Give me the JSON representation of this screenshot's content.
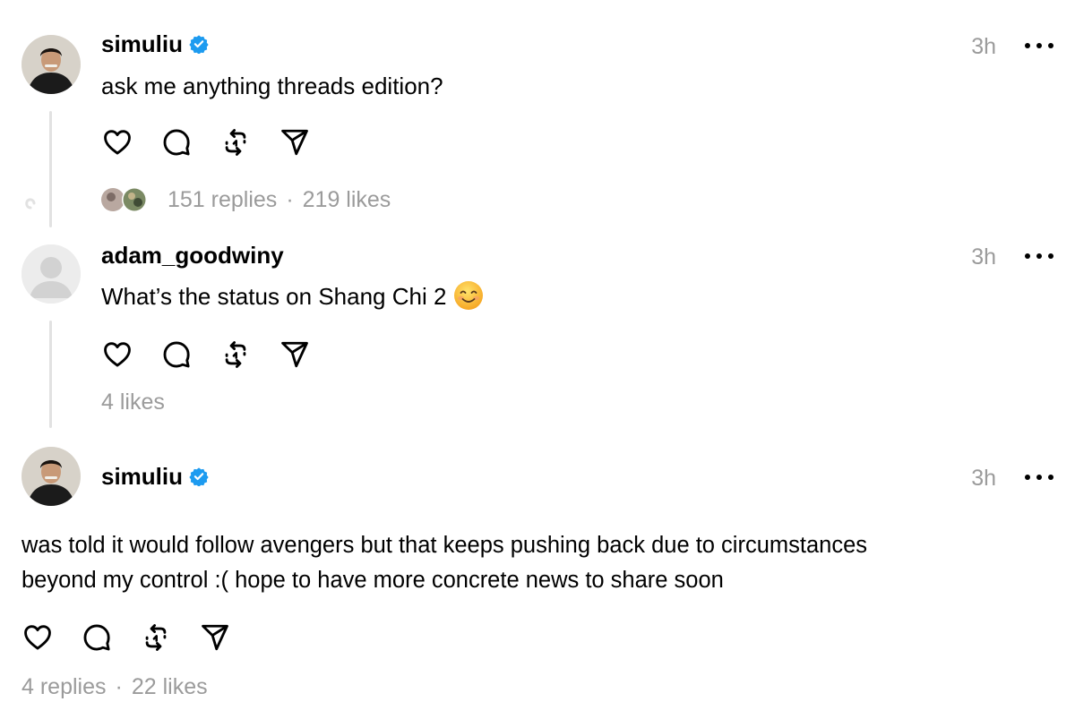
{
  "posts": [
    {
      "username": "simuliu",
      "verified": true,
      "time": "3h",
      "text": "ask me anything threads edition?",
      "replies": "151 replies",
      "separator": "·",
      "likes": "219 likes"
    },
    {
      "username": "adam_goodwiny",
      "verified": false,
      "time": "3h",
      "text": "What’s the status on Shang Chi 2",
      "emoji": "smiling-face-emoji",
      "likes": "4 likes"
    },
    {
      "username": "simuliu",
      "verified": true,
      "time": "3h",
      "text_line1": "was told it would follow avengers but that keeps pushing back due to circumstances",
      "text_line2": "beyond my control :( hope to have more concrete news to share soon",
      "replies": "4 replies",
      "separator": "·",
      "likes": "22 likes"
    }
  ],
  "icons": {
    "like": "heart-icon",
    "reply": "comment-icon",
    "repost": "repost-icon",
    "share": "send-icon",
    "more": "more-icon",
    "verified": "verified-badge-icon"
  },
  "colors": {
    "verified": "#1d9bf0",
    "muted_text": "#9b9b9b",
    "thread_line": "#e2e2e2"
  }
}
